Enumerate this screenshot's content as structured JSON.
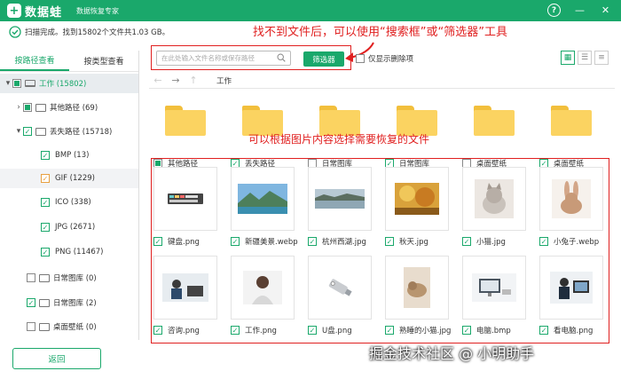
{
  "app": {
    "title": "数据蛙",
    "subtitle": "数据恢复专家",
    "help": "?",
    "minimize": "—",
    "close": "✕"
  },
  "status": {
    "text": "扫描完成。找到15802个文件共1.03 GB。"
  },
  "annotations": {
    "top": "找不到文件后，可以使用“搜索框”或“筛选器”工具",
    "middle": "可以根据图片内容选择需要恢复的文件"
  },
  "watermark": "掘金技术社区 @ 小明助手",
  "left_tabs": [
    {
      "label": "按路径查看"
    },
    {
      "label": "按类型查看"
    }
  ],
  "tree": [
    {
      "label": "工作 (15802)"
    },
    {
      "label": "其他路径 (69)"
    },
    {
      "label": "丢失路径 (15718)"
    },
    {
      "label": "BMP (13)"
    },
    {
      "label": "GIF (1229)"
    },
    {
      "label": "ICO (338)"
    },
    {
      "label": "JPG (2671)"
    },
    {
      "label": "PNG (11467)"
    },
    {
      "label": "日常图库 (0)"
    },
    {
      "label": "日常图库 (2)"
    },
    {
      "label": "桌面壁纸 (0)"
    }
  ],
  "back_button": "返回",
  "search": {
    "placeholder": "在此处输入文件名称或保存路径"
  },
  "filter_button": "筛选器",
  "only_deleted": "仅显示删除项",
  "breadcrumb": "工作",
  "folders": [
    {
      "name": "其他路径"
    },
    {
      "name": "丢失路径"
    },
    {
      "name": "日常图库"
    },
    {
      "name": "日常图库"
    },
    {
      "name": "桌面壁纸"
    },
    {
      "name": "桌面壁纸"
    }
  ],
  "images_row1": [
    {
      "name": "键盘.png"
    },
    {
      "name": "新疆美景.webp"
    },
    {
      "name": "杭州西湖.jpg"
    },
    {
      "name": "秋天.jpg"
    },
    {
      "name": "小猫.jpg"
    },
    {
      "name": "小兔子.webp"
    }
  ],
  "images_row2": [
    {
      "name": "咨询.png"
    },
    {
      "name": "工作.png"
    },
    {
      "name": "U盘.png"
    },
    {
      "name": "熟睡的小猫.jpg"
    },
    {
      "name": "电脑.bmp"
    },
    {
      "name": "看电脑.png"
    }
  ],
  "colors": {
    "brand": "#1aa86b",
    "annotation": "#e02020",
    "folder": "#fbd361"
  }
}
